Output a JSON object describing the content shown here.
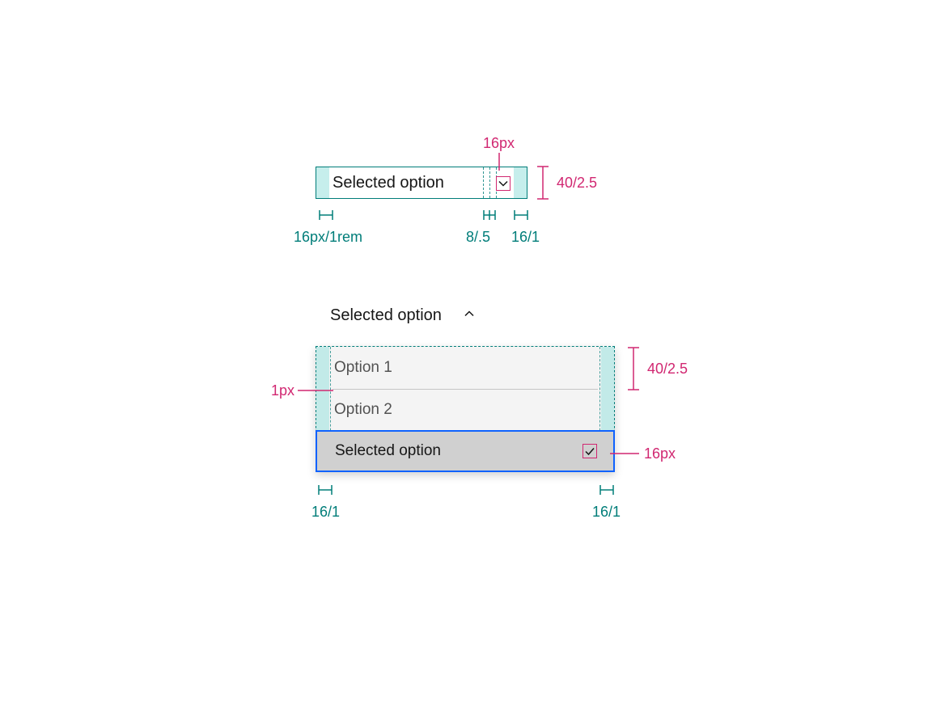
{
  "colors": {
    "teal": "#007d79",
    "pink": "#d12771",
    "tealFill": "#a0e3e0",
    "blue": "#0f62fe",
    "grayBg": "#f4f4f4",
    "graySel": "#d0d0d0",
    "textMuted": "#525252"
  },
  "closed": {
    "label": "Selected option",
    "iconSize": "16px",
    "height": "40/2.5",
    "paddingLeft": "16px/1rem",
    "gap": "8/.5",
    "paddingRight": "16/1"
  },
  "open": {
    "triggerLabel": "Selected option",
    "option1": "Option 1",
    "option2": "Option 2",
    "selectedLabel": "Selected option",
    "rowHeight": "40/2.5",
    "divider": "1px",
    "checkSize": "16px",
    "padLeft": "16/1",
    "padRight": "16/1"
  }
}
